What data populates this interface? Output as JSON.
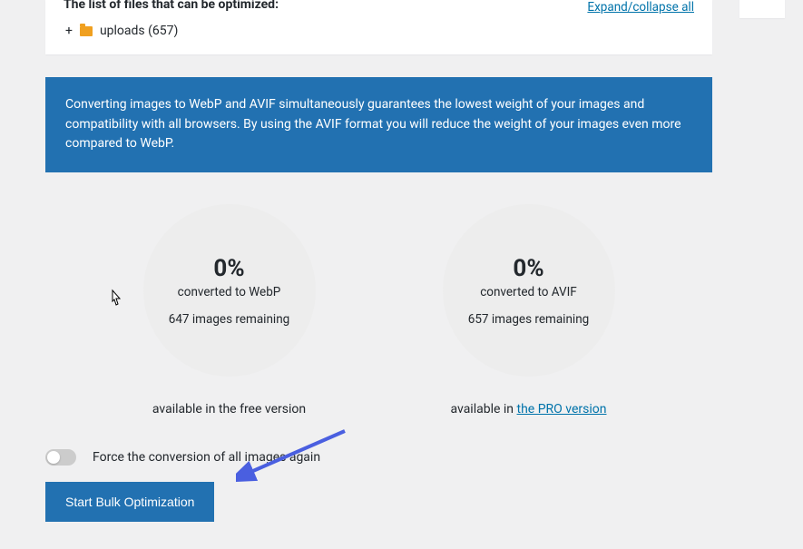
{
  "fileList": {
    "title": "The list of files that can be optimized:",
    "expandCollapse": "Expand/collapse all",
    "tree": {
      "label": "uploads (657)"
    }
  },
  "banner": {
    "text": "Converting images to WebP and AVIF simultaneously guarantees the lowest weight of your images and compatibility with all browsers. By using the AVIF format you will reduce the weight of your images even more compared to WebP."
  },
  "stats": {
    "webp": {
      "percent": "0%",
      "label": "converted to WebP",
      "remaining": "647 images remaining",
      "available": "available in the free version"
    },
    "avif": {
      "percent": "0%",
      "label": "converted to AVIF",
      "remaining": "657 images remaining",
      "availablePrefix": "available in ",
      "availableLink": "the PRO version"
    }
  },
  "toggle": {
    "label": "Force the conversion of all images again"
  },
  "actions": {
    "startBulk": "Start Bulk Optimization"
  }
}
